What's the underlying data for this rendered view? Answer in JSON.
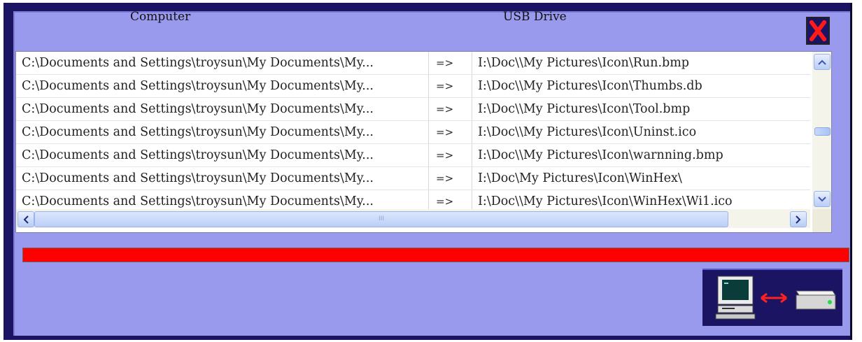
{
  "header": {
    "computer_label": "Computer",
    "usb_label": "USB Drive"
  },
  "list": {
    "rows": [
      {
        "source": "C:\\Documents and Settings\\troysun\\My Documents\\My...",
        "arrow": "=>",
        "dest": "I:\\Doc\\\\My Pictures\\Icon\\Run.bmp"
      },
      {
        "source": "C:\\Documents and Settings\\troysun\\My Documents\\My...",
        "arrow": "=>",
        "dest": "I:\\Doc\\\\My Pictures\\Icon\\Thumbs.db"
      },
      {
        "source": "C:\\Documents and Settings\\troysun\\My Documents\\My...",
        "arrow": "=>",
        "dest": "I:\\Doc\\\\My Pictures\\Icon\\Tool.bmp"
      },
      {
        "source": "C:\\Documents and Settings\\troysun\\My Documents\\My...",
        "arrow": "=>",
        "dest": "I:\\Doc\\\\My Pictures\\Icon\\Uninst.ico"
      },
      {
        "source": "C:\\Documents and Settings\\troysun\\My Documents\\My...",
        "arrow": "=>",
        "dest": "I:\\Doc\\\\My Pictures\\Icon\\warnning.bmp"
      },
      {
        "source": "C:\\Documents and Settings\\troysun\\My Documents\\My...",
        "arrow": "=>",
        "dest": "I:\\Doc\\My Pictures\\Icon\\WinHex\\"
      },
      {
        "source": "C:\\Documents and Settings\\troysun\\My Documents\\My...",
        "arrow": "=>",
        "dest": "I:\\Doc\\\\My Pictures\\Icon\\WinHex\\Wi1.ico"
      }
    ],
    "hscroll_grip": "III"
  },
  "progress": {
    "value": 1.0
  },
  "colors": {
    "window_frame": "#1a1462",
    "panel": "#9999ee",
    "progress_fill": "#ff0000",
    "close_x": "#ff1a1a"
  },
  "icons": {
    "close": "close-x-icon",
    "computer": "computer-icon",
    "sync": "sync-arrow-icon",
    "usb_drive": "usb-drive-icon"
  }
}
